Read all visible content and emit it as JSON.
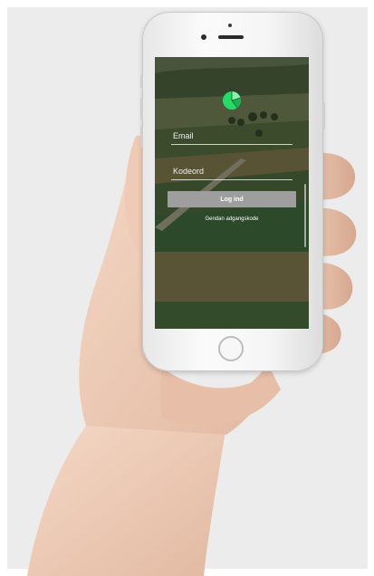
{
  "login": {
    "email_placeholder": "Email",
    "password_placeholder": "Kodeord",
    "login_label": "Log ind",
    "reset_label": "Gendan adgangskode"
  },
  "icons": {
    "logo": "green-pie-chart-logo",
    "home": "home-button"
  },
  "colors": {
    "logo_green": "#22dd66",
    "button_gray": "#9e9e9e",
    "text_white": "#ffffff"
  }
}
